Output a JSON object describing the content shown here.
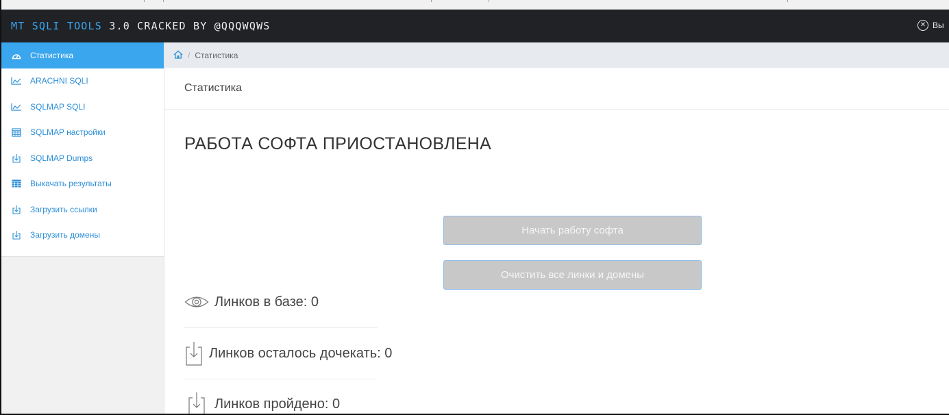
{
  "header": {
    "brand_accent": "MT SQLI TOOLS",
    "brand_rest": "3.0 CRACKED BY @QQQWQWS",
    "exit_label": "Вы"
  },
  "sidebar": {
    "items": [
      {
        "label": "Статистика",
        "icon": "dashboard-icon",
        "active": true
      },
      {
        "label": "ARACHNI SQLI",
        "icon": "line-chart-icon"
      },
      {
        "label": "SQLMAP SQLI",
        "icon": "line-chart-icon"
      },
      {
        "label": "SQLMAP настройки",
        "icon": "calendar-icon"
      },
      {
        "label": "SQLMAP Dumps",
        "icon": "download-icon"
      },
      {
        "label": "Выкачать результаты",
        "icon": "table-icon"
      },
      {
        "label": "Загрузить ссылки",
        "icon": "download-icon"
      },
      {
        "label": "Загрузить домены",
        "icon": "download-icon"
      }
    ]
  },
  "breadcrumb": {
    "sep": "/",
    "current": "Статистика"
  },
  "page": {
    "heading": "Статистика",
    "status_title": "РАБОТА СОФТА ПРИОСТАНОВЛЕНА"
  },
  "buttons": {
    "start": "Начать работу софта",
    "clear": "Очистить все линки и домены"
  },
  "stats": [
    {
      "label": "Линков в базе: 0",
      "icon": "eye-icon"
    },
    {
      "label": "Линков осталось дочекать: 0",
      "icon": "download-icon"
    },
    {
      "label": "Линков пройдено: 0",
      "icon": "download-icon"
    }
  ],
  "colors": {
    "accent": "#3aa6ee",
    "header_bg": "#202226",
    "button_bg": "#c8c8c8",
    "button_border": "#8cbcec"
  }
}
